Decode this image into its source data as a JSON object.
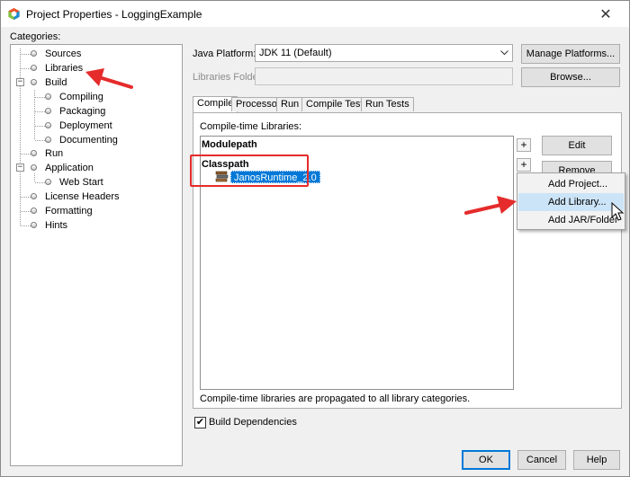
{
  "window": {
    "title": "Project Properties - LoggingExample",
    "close_glyph": "✕"
  },
  "categories": {
    "label": "Categories:",
    "items": [
      {
        "label": "Sources"
      },
      {
        "label": "Libraries"
      },
      {
        "label": "Build",
        "toggle": "−"
      },
      {
        "label": "Compiling"
      },
      {
        "label": "Packaging"
      },
      {
        "label": "Deployment"
      },
      {
        "label": "Documenting"
      },
      {
        "label": "Run"
      },
      {
        "label": "Application",
        "toggle": "−"
      },
      {
        "label": "Web Start"
      },
      {
        "label": "License Headers"
      },
      {
        "label": "Formatting"
      },
      {
        "label": "Hints"
      }
    ]
  },
  "platform": {
    "label": "Java Platform:",
    "value": "JDK 11 (Default)",
    "manage_button": "Manage Platforms..."
  },
  "libraries_folder": {
    "label": "Libraries Folder:",
    "browse_button": "Browse..."
  },
  "tabs": [
    {
      "label": "Compile",
      "active": true
    },
    {
      "label": "Processor"
    },
    {
      "label": "Run"
    },
    {
      "label": "Compile Tests"
    },
    {
      "label": "Run Tests"
    }
  ],
  "compile": {
    "list_label": "Compile-time Libraries:",
    "modulepath_label": "Modulepath",
    "classpath_label": "Classpath",
    "plus_glyph": "+",
    "selected_library": "JanosRuntime_2.0",
    "edit_button": "Edit",
    "remove_button": "Remove",
    "footnote": "Compile-time libraries are propagated to all library categories."
  },
  "context_menu": {
    "items": [
      {
        "label": "Add Project..."
      },
      {
        "label": "Add Library...",
        "highlighted": true
      },
      {
        "label": "Add JAR/Folder"
      }
    ]
  },
  "build_dependencies": {
    "label": "Build Dependencies",
    "checked": true,
    "check_glyph": "✔"
  },
  "footer": {
    "ok": "OK",
    "cancel": "Cancel",
    "help": "Help"
  },
  "colors": {
    "accent": "#0078d7",
    "annotation_red": "#e52b2b",
    "menu_highlight": "#cce4f7"
  }
}
